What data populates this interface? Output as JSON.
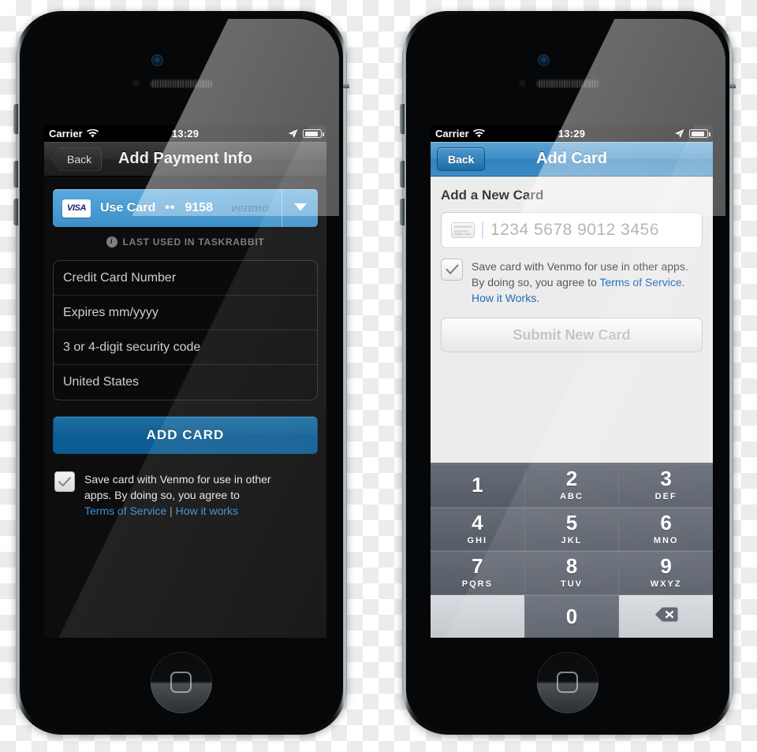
{
  "meta": {
    "accent_blue": "#3d8fc8",
    "dark_bg": "#0d0d0d",
    "light_bg": "#ececec",
    "link_blue": "#3a8dd0",
    "button_blue": "#125f93"
  },
  "status_bar": {
    "carrier": "Carrier",
    "time": "13:29",
    "wifi_icon": "wifi-icon",
    "location_icon": "location-arrow-icon",
    "battery_icon": "battery-icon"
  },
  "left_phone": {
    "nav": {
      "back_label": "Back",
      "title": "Add Payment Info"
    },
    "saved_card": {
      "brand": "VISA",
      "action_label": "Use Card",
      "mask": "••",
      "last4": "9158",
      "provider": "venmo",
      "caret_icon": "chevron-down-icon"
    },
    "last_used": {
      "info_icon": "info-icon",
      "text": "LAST USED IN TASKRABBIT"
    },
    "form_fields": [
      {
        "name": "credit-card-number",
        "placeholder": "Credit Card Number",
        "value": ""
      },
      {
        "name": "expiry",
        "placeholder": "Expires mm/yyyy",
        "value": ""
      },
      {
        "name": "security-code",
        "placeholder": "3 or 4-digit security code",
        "value": ""
      },
      {
        "name": "country",
        "placeholder": "United States",
        "value": "United States"
      }
    ],
    "primary_button": "ADD CARD",
    "save_consent": {
      "checked": true,
      "line1": "Save card with Venmo for use in other",
      "line2": "apps. By doing so, you agree to",
      "terms_link": "Terms of Service",
      "separator": "|",
      "how_link": "How it works"
    }
  },
  "right_phone": {
    "nav": {
      "back_label": "Back",
      "title": "Add Card"
    },
    "section_title": "Add a New Card",
    "card_input": {
      "icon": "credit-card-icon",
      "placeholder": "1234  5678  9012  3456",
      "value": ""
    },
    "save_consent": {
      "checked": true,
      "line1": "Save card with Venmo for use in other apps.",
      "line2_prefix": "By doing so, you agree to ",
      "terms_link": "Terms of Service",
      "line2_suffix": ".",
      "how_link": "How it Works",
      "how_suffix": "."
    },
    "submit_label": "Submit New Card",
    "keypad": [
      {
        "num": "1",
        "letters": ""
      },
      {
        "num": "2",
        "letters": "ABC"
      },
      {
        "num": "3",
        "letters": "DEF"
      },
      {
        "num": "4",
        "letters": "GHI"
      },
      {
        "num": "5",
        "letters": "JKL"
      },
      {
        "num": "6",
        "letters": "MNO"
      },
      {
        "num": "7",
        "letters": "PQRS"
      },
      {
        "num": "8",
        "letters": "TUV"
      },
      {
        "num": "9",
        "letters": "WXYZ"
      },
      {
        "num": "",
        "letters": ""
      },
      {
        "num": "0",
        "letters": ""
      },
      {
        "num": "",
        "letters": "",
        "icon": "backspace-icon"
      }
    ]
  }
}
